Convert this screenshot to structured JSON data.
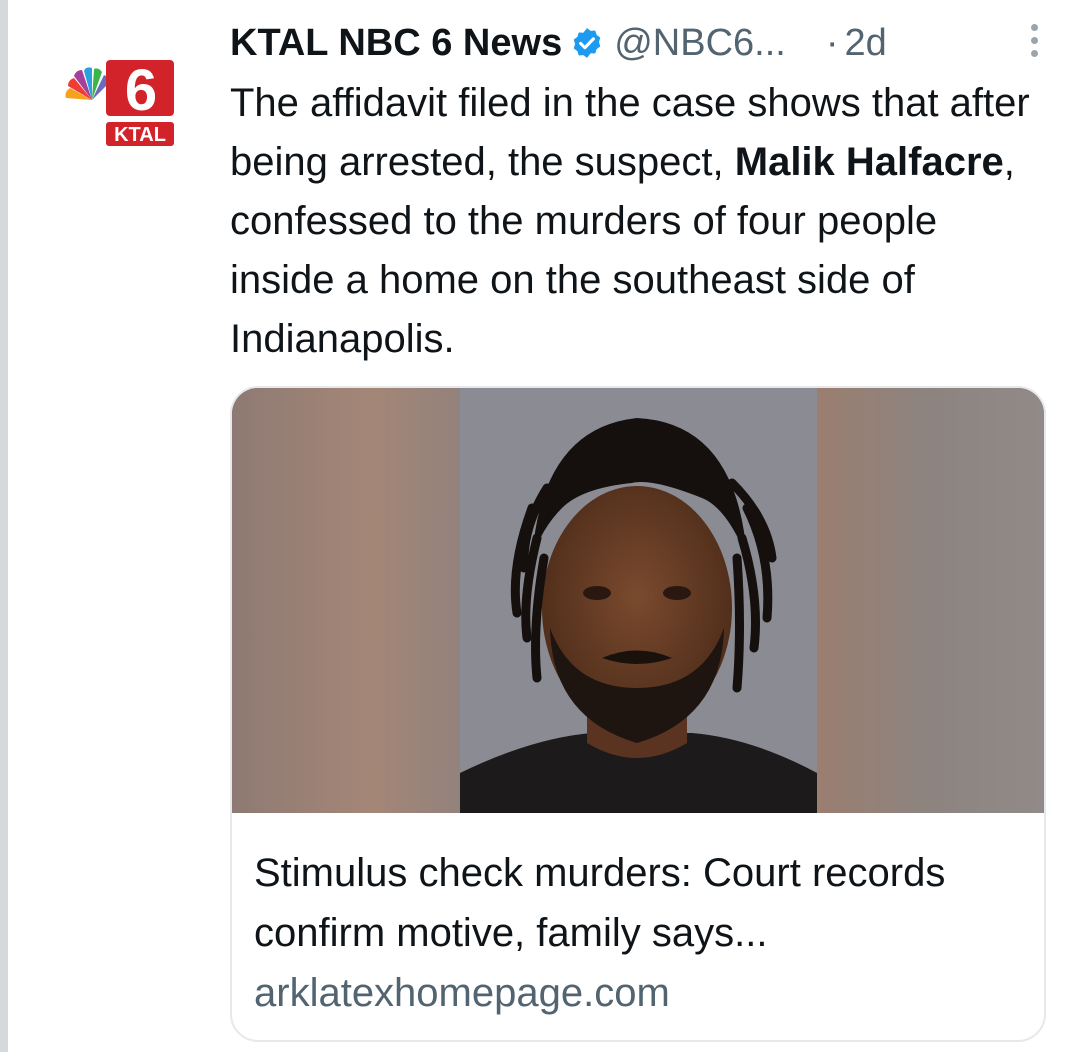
{
  "tweet": {
    "author": {
      "display_name": "KTAL NBC 6 News",
      "handle": "@NBC6...",
      "avatar_text": "KTAL",
      "avatar_number": "6",
      "verified_icon": "verified-badge-icon"
    },
    "separator": "·",
    "timestamp": "2d",
    "text_parts": {
      "part1": "The affidavit filed in the case shows that after being arrested, the suspect, ",
      "bold": "Malik Halfacre",
      "part2": ", confessed to the murders of four people inside a home on the southeast side of Indianapolis."
    },
    "link_card": {
      "title": "Stimulus check murders: Court records confirm motive, family says...",
      "domain": "arklatexhomepage.com",
      "image_icon": "portrait-photo"
    }
  },
  "colors": {
    "text_primary": "#0f1419",
    "text_secondary": "#536471",
    "verified_blue": "#1d9bf0",
    "card_border": "#e6e9ec",
    "ktal_red": "#d3232a"
  }
}
